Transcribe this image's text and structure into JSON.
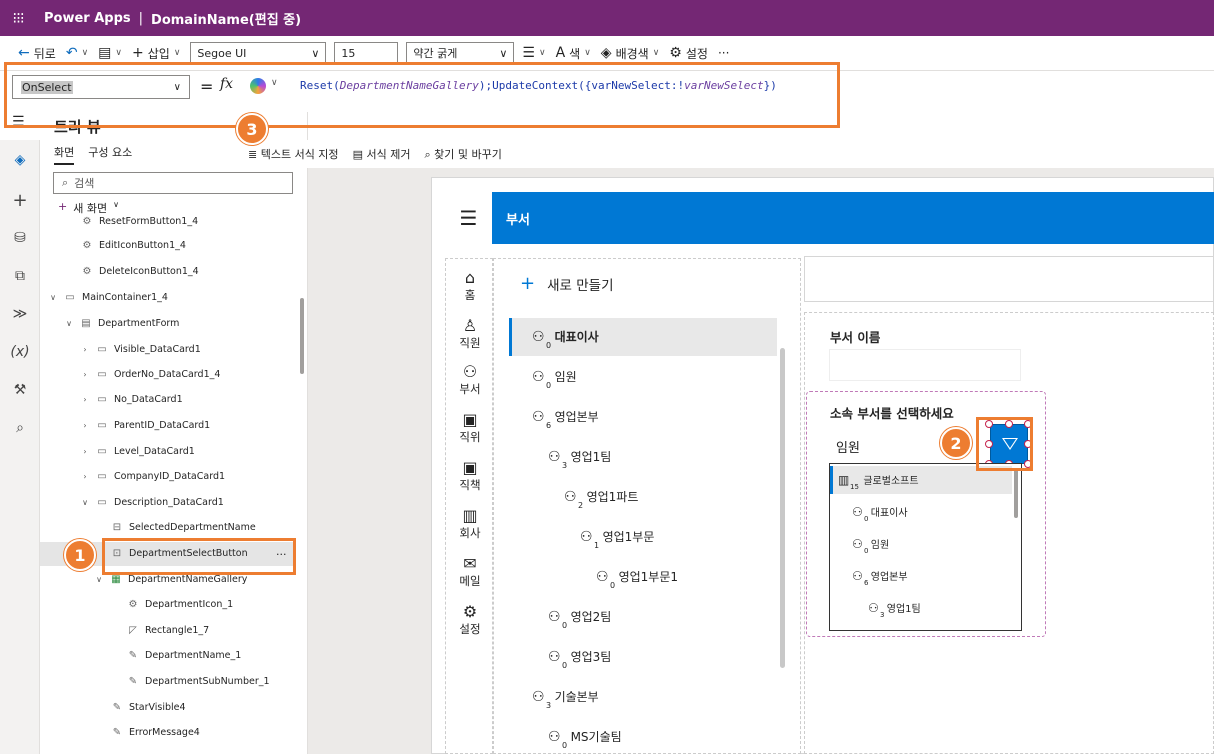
{
  "titlebar": {
    "app": "Power Apps",
    "sep": "|",
    "doc": "DomainName(편집 중)"
  },
  "toolbar": {
    "undo_label": "뒤로",
    "insert_label": "삽입",
    "font_value": "Segoe UI",
    "size_value": "15",
    "weight_value": "약간 굵게",
    "color_label": "색",
    "fill_label": "배경색",
    "settings_label": "설정",
    "more_label": "···"
  },
  "formula": {
    "property": "OnSelect",
    "eq": "=",
    "fx": "fx",
    "text_parts": [
      "Reset(",
      "DepartmentNameGallery",
      ");UpdateContext({varNewSelect:!",
      "varNewSelect",
      "})"
    ]
  },
  "formatbar": {
    "format_text": "텍스트 서식 지정",
    "remove_format": "서식 제거",
    "find_replace": "찾기 및 바꾸기"
  },
  "tree": {
    "title": "트리 뷰",
    "tab_screens": "화면",
    "tab_components": "구성 요소",
    "search_placeholder": "검색",
    "new_screen": "새 화면",
    "items": [
      "ResetFormButton1_4",
      "EditIconButton1_4",
      "DeleteIconButton1_4",
      "MainContainer1_4",
      "DepartmentForm",
      "Visible_DataCard1",
      "OrderNo_DataCard1_4",
      "No_DataCard1",
      "ParentID_DataCard1",
      "Level_DataCard1",
      "CompanyID_DataCard1",
      "Description_DataCard1",
      "SelectedDepartmentName",
      "DepartmentSelectButton",
      "DepartmentNameGallery",
      "DepartmentIcon_1",
      "Rectangle1_7",
      "DepartmentName_1",
      "DepartmentSubNumber_1",
      "StarVisible4",
      "ErrorMessage4"
    ],
    "selected_more": "···"
  },
  "app": {
    "header_title": "부서",
    "nav": [
      "홈",
      "직원",
      "부서",
      "직위",
      "직책",
      "회사",
      "메일",
      "설정"
    ],
    "new_button": "새로 만들기",
    "gallery": [
      {
        "name": "대표이사",
        "count": "0"
      },
      {
        "name": "임원",
        "count": "0"
      },
      {
        "name": "영업본부",
        "count": "6"
      },
      {
        "name": "영업1팀",
        "count": "3"
      },
      {
        "name": "영업1파트",
        "count": "2"
      },
      {
        "name": "영업1부문",
        "count": "1"
      },
      {
        "name": "영업1부문1",
        "count": "0"
      },
      {
        "name": "영업2팀",
        "count": "0"
      },
      {
        "name": "영업3팀",
        "count": "0"
      },
      {
        "name": "기술본부",
        "count": "3"
      },
      {
        "name": "MS기술팀",
        "count": "0"
      }
    ],
    "form": {
      "name_label": "부서 이름",
      "dept_label": "소속 부서를 선택하세요",
      "dept_value": "임원",
      "dropdown": [
        {
          "name": "글로벌소프트",
          "count": "15"
        },
        {
          "name": "대표이사",
          "count": "0"
        },
        {
          "name": "임원",
          "count": "0"
        },
        {
          "name": "영업본부",
          "count": "6"
        },
        {
          "name": "영업1팀",
          "count": "3"
        }
      ]
    }
  },
  "callouts": [
    "1",
    "2",
    "3"
  ],
  "colors": {
    "titlebar": "#742774",
    "accent": "#0078d4",
    "callout": "#ed7d31"
  }
}
